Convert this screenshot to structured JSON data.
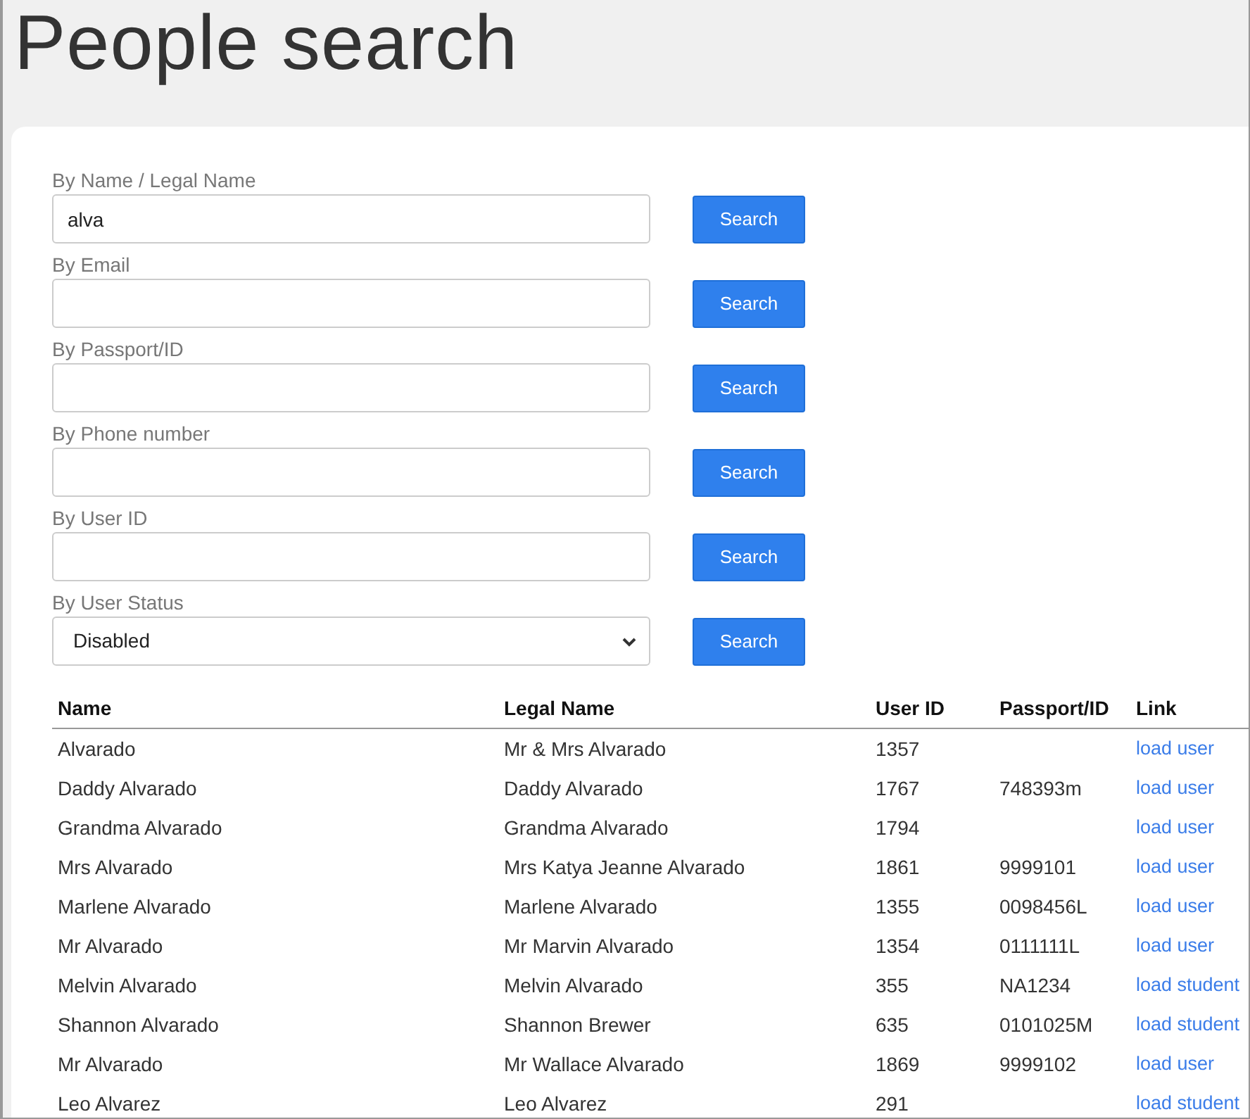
{
  "title": "People search",
  "filters": [
    {
      "label": "By Name / Legal Name",
      "kind": "text",
      "value": "alva",
      "button": "Search"
    },
    {
      "label": "By Email",
      "kind": "text",
      "button": "Search"
    },
    {
      "label": "By Passport/ID",
      "kind": "text",
      "button": "Search"
    },
    {
      "label": "By Phone number",
      "kind": "text",
      "button": "Search"
    },
    {
      "label": "By User ID",
      "kind": "text",
      "button": "Search"
    },
    {
      "label": "By User Status",
      "kind": "select",
      "value": "Disabled",
      "button": "Search"
    }
  ],
  "table": {
    "columns": [
      "Name",
      "Legal Name",
      "User ID",
      "Passport/ID",
      "Link"
    ],
    "rows": [
      {
        "name": "Alvarado",
        "legal_name": "Mr & Mrs Alvarado",
        "user_id": "1357",
        "link": "load user"
      },
      {
        "name": "Daddy Alvarado",
        "legal_name": "Daddy Alvarado",
        "user_id": "1767",
        "passport": "748393m",
        "link": "load user"
      },
      {
        "name": "Grandma Alvarado",
        "legal_name": "Grandma Alvarado",
        "user_id": "1794",
        "link": "load user"
      },
      {
        "name": "Mrs Alvarado",
        "legal_name": "Mrs Katya Jeanne Alvarado",
        "user_id": "1861",
        "passport": "9999101",
        "link": "load user"
      },
      {
        "name": "Marlene Alvarado",
        "legal_name": "Marlene Alvarado",
        "user_id": "1355",
        "passport": "0098456L",
        "link": "load user"
      },
      {
        "name": "Mr Alvarado",
        "legal_name": "Mr Marvin Alvarado",
        "user_id": "1354",
        "passport": "0111111L",
        "link": "load user"
      },
      {
        "name": "Melvin Alvarado",
        "legal_name": "Melvin Alvarado",
        "user_id": "355",
        "passport": "NA1234",
        "link": "load student"
      },
      {
        "name": "Shannon Alvarado",
        "legal_name": "Shannon Brewer",
        "user_id": "635",
        "passport": "0101025M",
        "link": "load student"
      },
      {
        "name": "Mr Alvarado",
        "legal_name": "Mr Wallace Alvarado",
        "user_id": "1869",
        "passport": "9999102",
        "link": "load user"
      },
      {
        "name": "Leo Alvarez",
        "legal_name": "Leo Alvarez",
        "user_id": "291",
        "link": "load student"
      }
    ]
  }
}
